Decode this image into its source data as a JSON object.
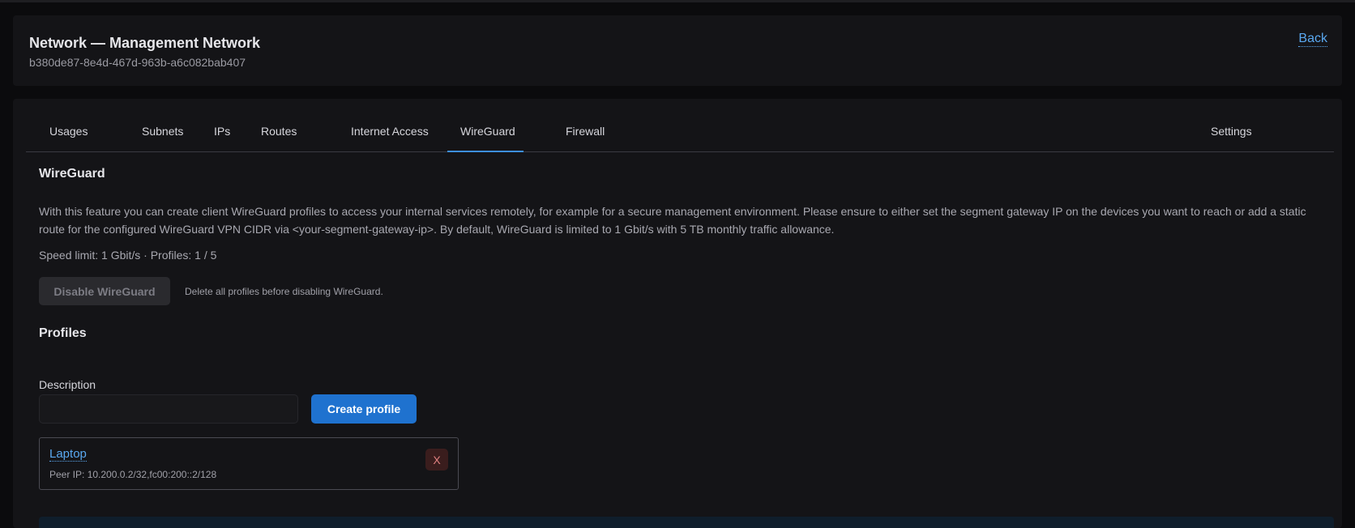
{
  "header": {
    "title": "Network — Management Network",
    "id": "b380de87-8e4d-467d-963b-a6c082bab407",
    "back_label": "Back"
  },
  "tabs": [
    {
      "label": "Usages",
      "active": false
    },
    {
      "label": "Subnets",
      "active": false
    },
    {
      "label": "IPs",
      "active": false
    },
    {
      "label": "Routes",
      "active": false
    },
    {
      "label": "Internet Access",
      "active": false
    },
    {
      "label": "WireGuard",
      "active": true
    },
    {
      "label": "Firewall",
      "active": false
    },
    {
      "label": "Settings",
      "active": false
    }
  ],
  "wireguard": {
    "title": "WireGuard",
    "description": "With this feature you can create client WireGuard profiles to access your internal services remotely, for example for a secure management environment. Please ensure to either set the segment gateway IP on the devices you want to reach or add a static route for the configured WireGuard VPN CIDR via <your-segment-gateway-ip>. By default, WireGuard is limited to 1 Gbit/s with 5 TB monthly traffic allowance.",
    "speed_info": "Speed limit: 1 Gbit/s · Profiles: 1 / 5",
    "disable_label": "Disable WireGuard",
    "disable_hint": "Delete all profiles before disabling WireGuard."
  },
  "profiles": {
    "title": "Profiles",
    "description_label": "Description",
    "description_value": "",
    "create_label": "Create profile",
    "items": [
      {
        "name": "Laptop",
        "peer_ip": "Peer IP: 10.200.0.2/32,fc00:200::2/128",
        "delete_label": "X"
      }
    ]
  },
  "colors": {
    "accent": "#1f72cf",
    "link": "#5aa8f0",
    "danger": "#e08080",
    "background": "#0b0b0d",
    "card": "#141417"
  }
}
